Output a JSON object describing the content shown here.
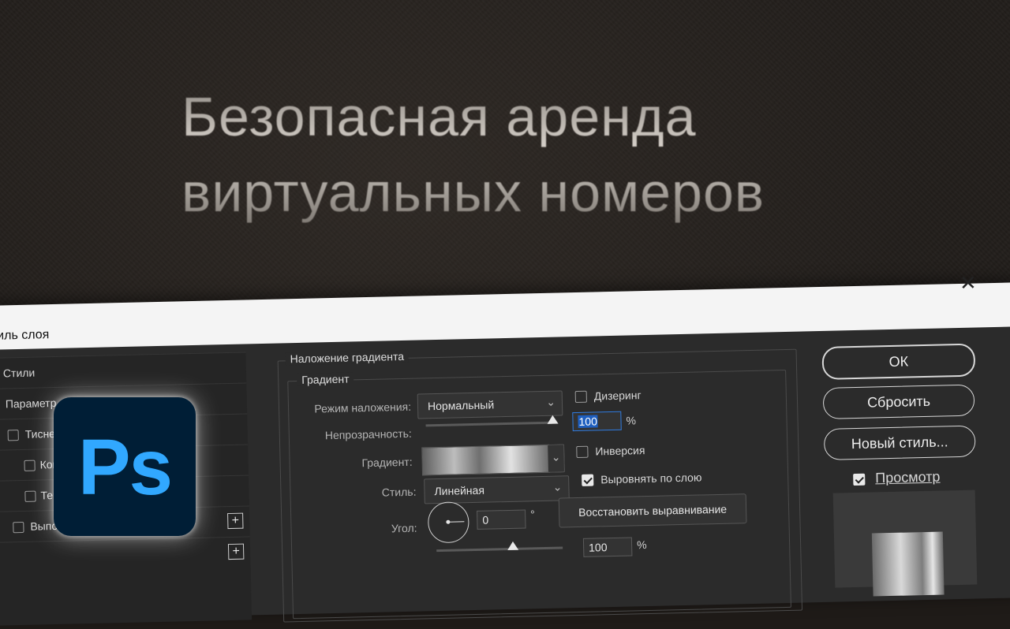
{
  "background": {
    "headline_lines": [
      "Безопасная аренда",
      "виртуальных номеров"
    ]
  },
  "dialog": {
    "title": "тиль слоя",
    "close_glyph": "✕",
    "left_list": {
      "items": [
        {
          "label": "Стили"
        },
        {
          "label": "Параметр"
        },
        {
          "label": "Тисне"
        },
        {
          "label": "Кон"
        },
        {
          "label": "Тек"
        },
        {
          "label": "Выполнить обводку"
        },
        {
          "label": ""
        }
      ],
      "plus_glyph": "+"
    },
    "section_title": "Наложение градиента",
    "group_title": "Градиент",
    "fields": {
      "blend_mode_label": "Режим наложения:",
      "blend_mode_value": "Нормальный",
      "opacity_label": "Непрозрачность:",
      "opacity_value": "100",
      "opacity_unit": "%",
      "gradient_label": "Градиент:",
      "style_label": "Стиль:",
      "style_value": "Линейная",
      "angle_label": "Угол:",
      "angle_value": "0",
      "angle_unit": "°",
      "scale_value": "100",
      "scale_unit": "%"
    },
    "checkboxes": {
      "dither": {
        "label": "Дизеринг",
        "checked": false
      },
      "reverse": {
        "label": "Инверсия",
        "checked": false
      },
      "align": {
        "label": "Выровнять по слою",
        "checked": true
      }
    },
    "reset_alignment_button": "Восстановить выравнивание",
    "right": {
      "ok": "ОК",
      "reset": "Сбросить",
      "new_style": "Новый стиль...",
      "preview_label": "Просмотр",
      "preview_checked": true
    },
    "chevron_glyph": "⌄"
  },
  "logo": {
    "text": "Ps",
    "color": "#31a8ff",
    "bg": "#001e36"
  }
}
